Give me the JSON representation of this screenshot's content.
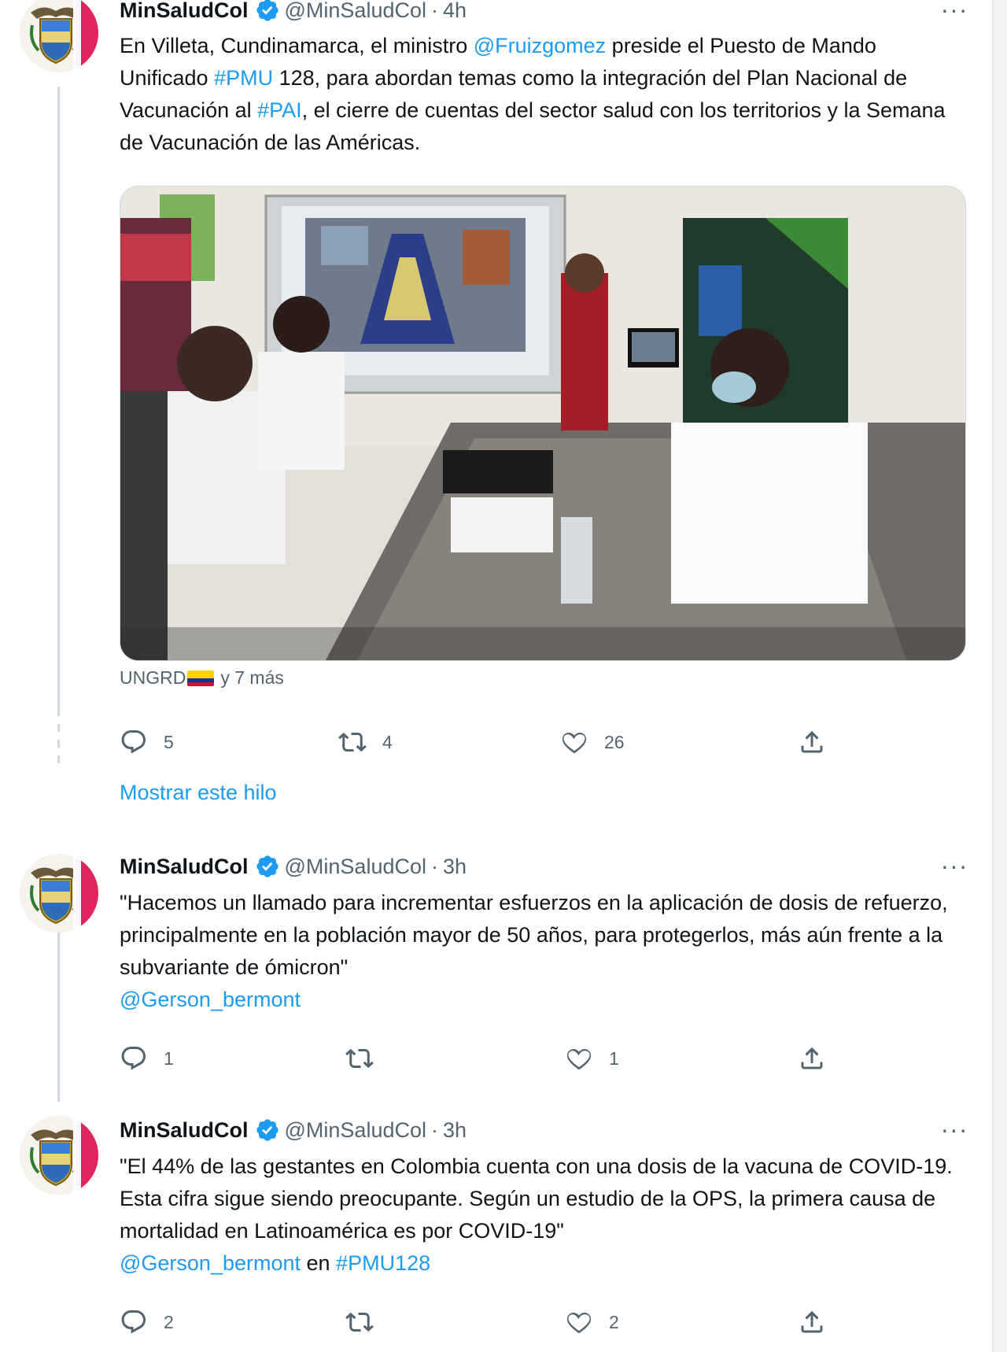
{
  "colors": {
    "link": "#1d9bf0",
    "secondary_text": "#536471",
    "verified": "#1d9bf0",
    "brand_pink": "#e0245e"
  },
  "tweets": [
    {
      "name": "MinSaludCol",
      "handle": "@MinSaludCol",
      "separator": "·",
      "time": "4h",
      "more": "···",
      "text_parts": [
        "En Villeta, Cundinamarca, el ministro ",
        "@Fruizgomez",
        " preside el Puesto de Mando Unificado ",
        "#PMU",
        " 128, para abordan temas como la integración del Plan Nacional de Vacunación al ",
        "#PAI",
        ", el cierre de cuentas del sector salud con los territorios y la Semana de Vacunación de las Américas."
      ],
      "tagged": {
        "label": "UNGRD",
        "suffix": "y 7 más"
      },
      "replies": "5",
      "retweets": "4",
      "likes": "26",
      "show_thread": "Mostrar este hilo"
    },
    {
      "name": "MinSaludCol",
      "handle": "@MinSaludCol",
      "separator": "·",
      "time": "3h",
      "more": "···",
      "text_parts": [
        "\"Hacemos un llamado para incrementar esfuerzos en la aplicación de dosis de refuerzo, principalmente en la población mayor de 50 años, para protegerlos, más aún frente a la subvariante de ómicron\"",
        "@Gerson_bermont"
      ],
      "replies": "1",
      "retweets": "",
      "likes": "1"
    },
    {
      "name": "MinSaludCol",
      "handle": "@MinSaludCol",
      "separator": "·",
      "time": "3h",
      "more": "···",
      "text_parts": [
        "\"El 44% de las gestantes en Colombia cuenta con una dosis de la vacuna de COVID-19. Esta cifra sigue siendo preocupante. Según un estudio de la OPS, la primera causa de mortalidad en Latinoamérica es por COVID-19\"",
        "@Gerson_bermont",
        " en ",
        "#PMU128"
      ],
      "replies": "2",
      "retweets": "",
      "likes": "2"
    }
  ],
  "icons": {
    "verified": "verified-badge-icon",
    "reply": "reply-icon",
    "retweet": "retweet-icon",
    "like": "heart-icon",
    "share": "share-icon",
    "more": "more-options-icon",
    "avatar": "colombia-coat-of-arms-icon",
    "flag": "colombia-flag-icon"
  }
}
